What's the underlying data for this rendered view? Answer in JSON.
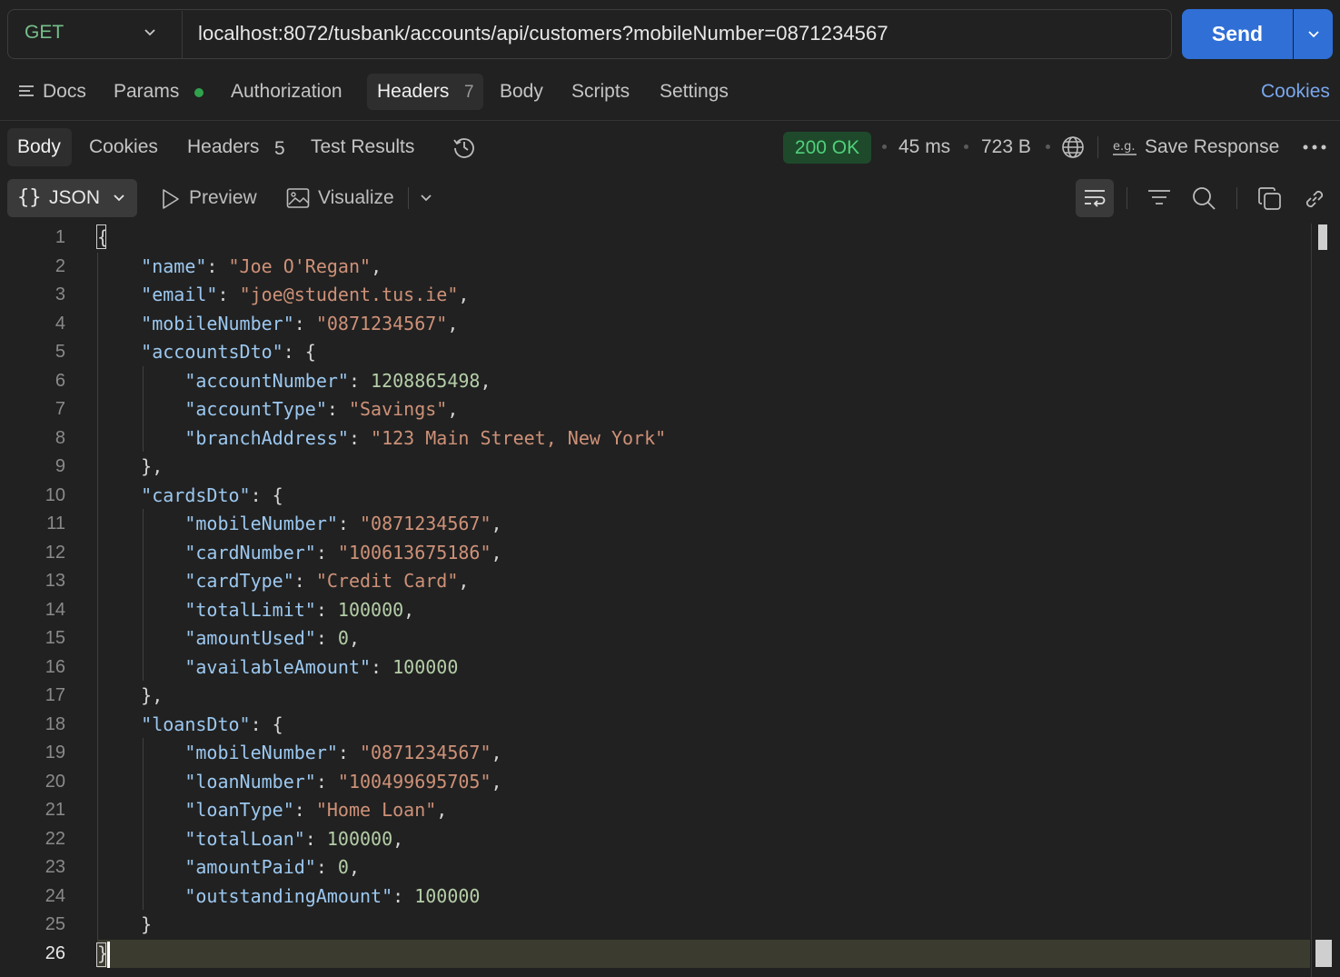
{
  "request": {
    "method": "GET",
    "url": "localhost:8072/tusbank/accounts/api/customers?mobileNumber=0871234567",
    "send_label": "Send"
  },
  "request_tabs": {
    "docs": "Docs",
    "params": "Params",
    "authorization": "Authorization",
    "headers": "Headers",
    "headers_count": "7",
    "body": "Body",
    "scripts": "Scripts",
    "settings": "Settings",
    "cookies": "Cookies"
  },
  "response_tabs": {
    "body": "Body",
    "cookies": "Cookies",
    "headers": "Headers",
    "headers_count": "5",
    "test_results": "Test Results"
  },
  "response_meta": {
    "status": "200 OK",
    "time": "45 ms",
    "size": "723 B",
    "save_response": "Save Response",
    "status_color": "#4fd07a"
  },
  "format_bar": {
    "json": "JSON",
    "preview": "Preview",
    "visualize": "Visualize"
  },
  "editor": {
    "line_numbers": [
      "1",
      "2",
      "3",
      "4",
      "5",
      "6",
      "7",
      "8",
      "9",
      "10",
      "11",
      "12",
      "13",
      "14",
      "15",
      "16",
      "17",
      "18",
      "19",
      "20",
      "21",
      "22",
      "23",
      "24",
      "25",
      "26"
    ],
    "lines": [
      "{",
      "    \"name\": \"Joe O'Regan\",",
      "    \"email\": \"joe@student.tus.ie\",",
      "    \"mobileNumber\": \"0871234567\",",
      "    \"accountsDto\": {",
      "        \"accountNumber\": 1208865498,",
      "        \"accountType\": \"Savings\",",
      "        \"branchAddress\": \"123 Main Street, New York\"",
      "    },",
      "    \"cardsDto\": {",
      "        \"mobileNumber\": \"0871234567\",",
      "        \"cardNumber\": \"100613675186\",",
      "        \"cardType\": \"Credit Card\",",
      "        \"totalLimit\": 100000,",
      "        \"amountUsed\": 0,",
      "        \"availableAmount\": 100000",
      "    },",
      "    \"loansDto\": {",
      "        \"mobileNumber\": \"0871234567\",",
      "        \"loanNumber\": \"100499695705\",",
      "        \"loanType\": \"Home Loan\",",
      "        \"totalLoan\": 100000,",
      "        \"amountPaid\": 0,",
      "        \"outstandingAmount\": 100000",
      "    }",
      "}"
    ]
  },
  "colors": {
    "accent": "#2f6fd6",
    "key": "#9cc8f0",
    "string": "#ce9178",
    "number": "#b5cea8"
  }
}
